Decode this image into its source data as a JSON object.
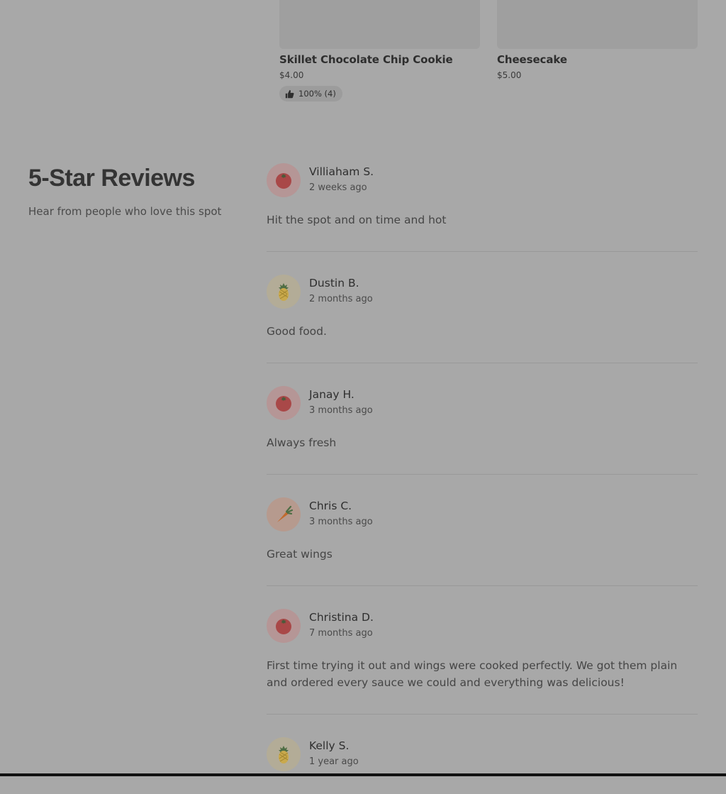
{
  "menu_items": [
    {
      "name": "Skillet Chocolate Chip Cookie",
      "price": "$4.00",
      "rating": "100% (4)"
    },
    {
      "name": "Cheesecake",
      "price": "$5.00"
    }
  ],
  "reviews_section": {
    "title": "5-Star Reviews",
    "subtitle": "Hear from people who love this spot",
    "reviews": [
      {
        "name": "Villiaham S.",
        "date": "2 weeks ago",
        "avatar": "tomato-icon",
        "text": "Hit the spot and on time and hot"
      },
      {
        "name": "Dustin B.",
        "date": "2 months ago",
        "avatar": "pineapple-icon",
        "text": "Good food."
      },
      {
        "name": "Janay H.",
        "date": "3 months ago",
        "avatar": "tomato-icon",
        "text": "Always fresh"
      },
      {
        "name": "Chris C.",
        "date": "3 months ago",
        "avatar": "carrot-icon",
        "text": "Great wings"
      },
      {
        "name": "Christina D.",
        "date": "7 months ago",
        "avatar": "tomato-icon",
        "text": "First time trying it out and wings were cooked perfectly. We got them plain and ordered every sauce we could and everything was delicious!"
      },
      {
        "name": "Kelly S.",
        "date": "1 year ago",
        "avatar": "pineapple-icon",
        "text": ""
      }
    ]
  }
}
